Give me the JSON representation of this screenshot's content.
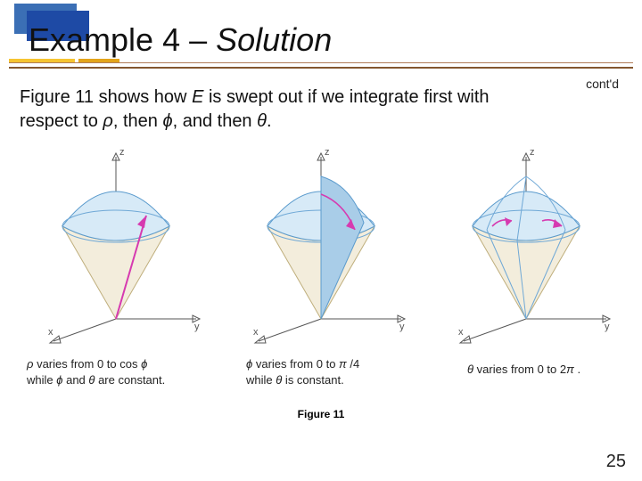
{
  "header": {
    "title_plain": "Example 4 – ",
    "title_italic": "Solution",
    "contd": "cont'd"
  },
  "body": {
    "line1_a": "Figure 11 shows how ",
    "line1_var": "E",
    "line1_b": " is swept out if we integrate first with",
    "line2_a": "respect to ",
    "line2_b": ", then ",
    "line2_c": ", and then ",
    "line2_d": "."
  },
  "symbols": {
    "rho": "ρ",
    "phi": "ϕ",
    "theta": "θ",
    "pi": "π"
  },
  "axes": {
    "x": "x",
    "y": "y",
    "z": "z"
  },
  "captions": {
    "c1_a": " varies from 0 to cos ",
    "c1_b": "while ",
    "c1_c": " and ",
    "c1_d": " are constant.",
    "c2_a": " varies from 0 to ",
    "c2_b": "while ",
    "c2_c": " is constant.",
    "c2_frac": " /4",
    "c3_a": " varies from 0 to 2",
    "c3_b": " ."
  },
  "figure_label": "Figure 11",
  "page": "25"
}
